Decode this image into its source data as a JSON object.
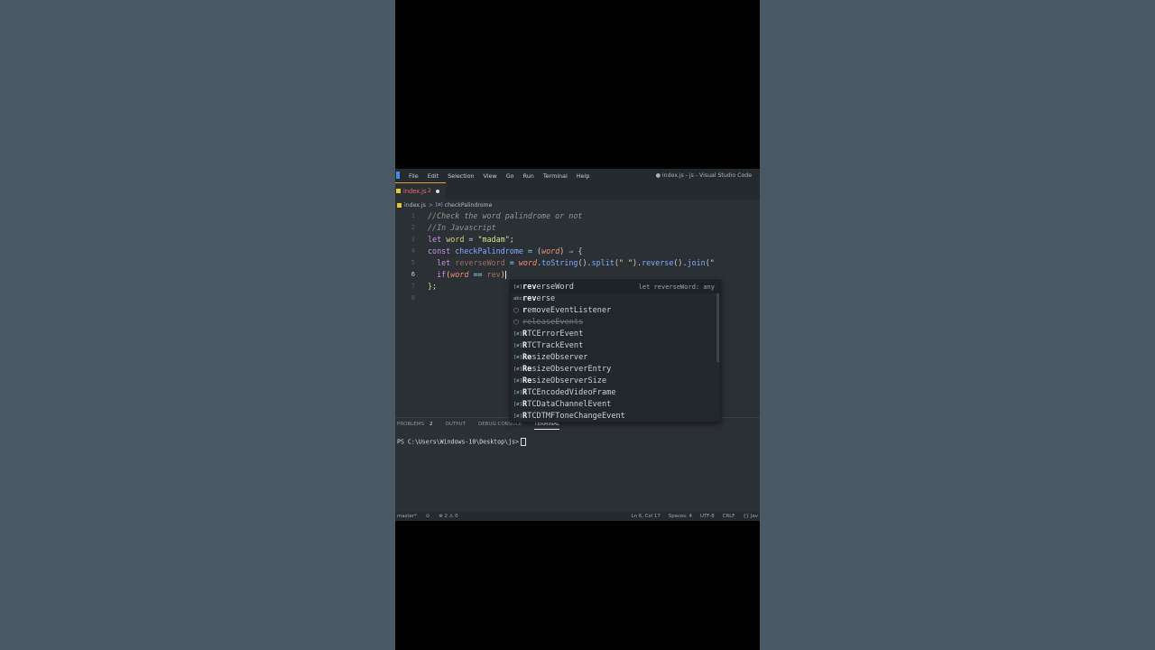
{
  "window": {
    "title": "● index.js - js - Visual Studio Code",
    "menu": [
      "File",
      "Edit",
      "Selection",
      "View",
      "Go",
      "Run",
      "Terminal",
      "Help"
    ]
  },
  "tab": {
    "name": "index.js",
    "problems": "2"
  },
  "breadcrumb": {
    "file": "index.js",
    "symbol": "checkPalindrome"
  },
  "editor": {
    "line_numbers": [
      "1",
      "2",
      "3",
      "4",
      "5",
      "6",
      "7",
      "8"
    ],
    "active_line": "6"
  },
  "suggestions": {
    "detail": "let reverseWord: any",
    "items": [
      {
        "icon": "variable-icon",
        "label": "reverseWord",
        "match": "rev"
      },
      {
        "icon": "text-icon",
        "label": "reverse",
        "match": "rev"
      },
      {
        "icon": "method-icon",
        "label": "removeEventListener",
        "match": "r"
      },
      {
        "icon": "method-icon",
        "label": "releaseEvents",
        "match": ""
      },
      {
        "icon": "variable-icon",
        "label": "RTCErrorEvent",
        "match": "R"
      },
      {
        "icon": "variable-icon",
        "label": "RTCTrackEvent",
        "match": "R"
      },
      {
        "icon": "variable-icon",
        "label": "ResizeObserver",
        "match": "Re"
      },
      {
        "icon": "variable-icon",
        "label": "ResizeObserverEntry",
        "match": "Re"
      },
      {
        "icon": "variable-icon",
        "label": "ResizeObserverSize",
        "match": "Re"
      },
      {
        "icon": "variable-icon",
        "label": "RTCEncodedVideoFrame",
        "match": "R"
      },
      {
        "icon": "variable-icon",
        "label": "RTCDataChannelEvent",
        "match": "R"
      },
      {
        "icon": "variable-icon",
        "label": "RTCDTMFToneChangeEvent",
        "match": "R"
      }
    ]
  },
  "panel": {
    "tabs": [
      "PROBLEMS",
      "OUTPUT",
      "DEBUG CONSOLE",
      "TERMINAL"
    ],
    "problems_badge": "2",
    "terminal_prompt": "PS C:\\Users\\Windows-10\\Desktop\\js>"
  },
  "status": {
    "branch": "master*",
    "errors": "⊗ 2 ⚠ 0",
    "position": "Ln 6, Col 17",
    "spaces": "Spaces: 4",
    "encoding": "UTF-8",
    "eol": "CRLF",
    "language": "{} Jav"
  },
  "colors": {
    "accent": "#3b8eea",
    "modified_tab": "#e6726c",
    "background": "#2b3035"
  }
}
